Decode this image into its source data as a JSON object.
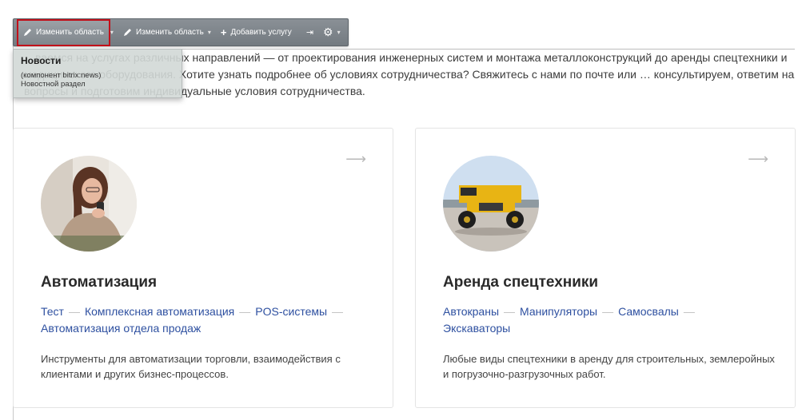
{
  "toolbar": {
    "edit_area_active": "Изменить область",
    "edit_area": "Изменить область",
    "add_service": "Добавить услугу"
  },
  "tooltip": {
    "title": "Новости",
    "line1": "(компонент bitrix:news)",
    "line2": "Новостной раздел"
  },
  "intro": {
    "text": "…ваемся на услугах различных направлений — от проектирования инженерных систем и монтажа металлоконструкций до аренды спецтехники и медицинского оборудования. Хотите узнать подробнее об условиях сотрудничества? Свяжитесь с нами по почте или … консультируем, ответим на вопросы и подготовим индивидуальные условия сотрудничества."
  },
  "cards": [
    {
      "title": "Автоматизация",
      "links": [
        "Тест",
        "Комплексная автоматизация",
        "POS-системы",
        "Автоматизация отдела продаж"
      ],
      "description": "Инструменты для автоматизации торговли, взаимодействия с клиентами и других бизнес-процессов.",
      "image": "woman-with-coffee-photo"
    },
    {
      "title": "Аренда спецтехники",
      "links": [
        "Автокраны",
        "Манипуляторы",
        "Самосвалы",
        "Экскаваторы"
      ],
      "description": "Любые виды спецтехники в аренду для строительных, землеройных и погрузочно-разгрузочных работ.",
      "image": "yellow-dump-truck-photo"
    }
  ],
  "colors": {
    "link": "#2e50a0",
    "toolbar": "#7d8389",
    "active_border": "#c2101a"
  }
}
